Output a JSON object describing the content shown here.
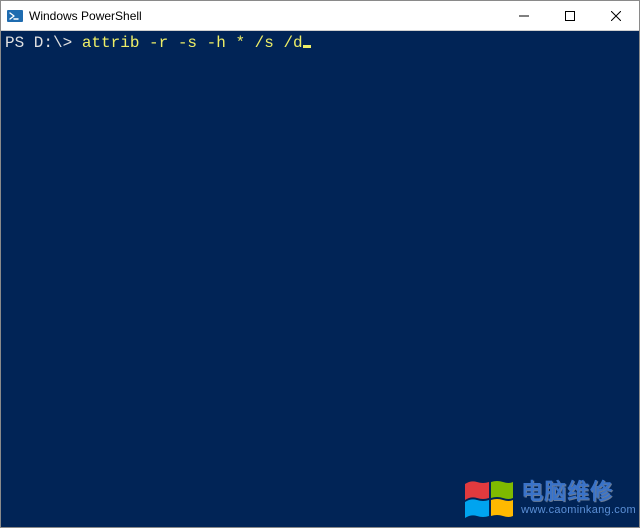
{
  "window": {
    "title": "Windows PowerShell",
    "icon_name": "powershell-icon"
  },
  "terminal": {
    "prompt": "PS D:\\> ",
    "command": "attrib -r -s -h * /s /d"
  },
  "watermark": {
    "title": "电脑维修",
    "url": "www.caominkang.com"
  },
  "colors": {
    "terminal_bg": "#012456",
    "command_color": "#eeee66",
    "prompt_color": "#e0e0e0"
  }
}
